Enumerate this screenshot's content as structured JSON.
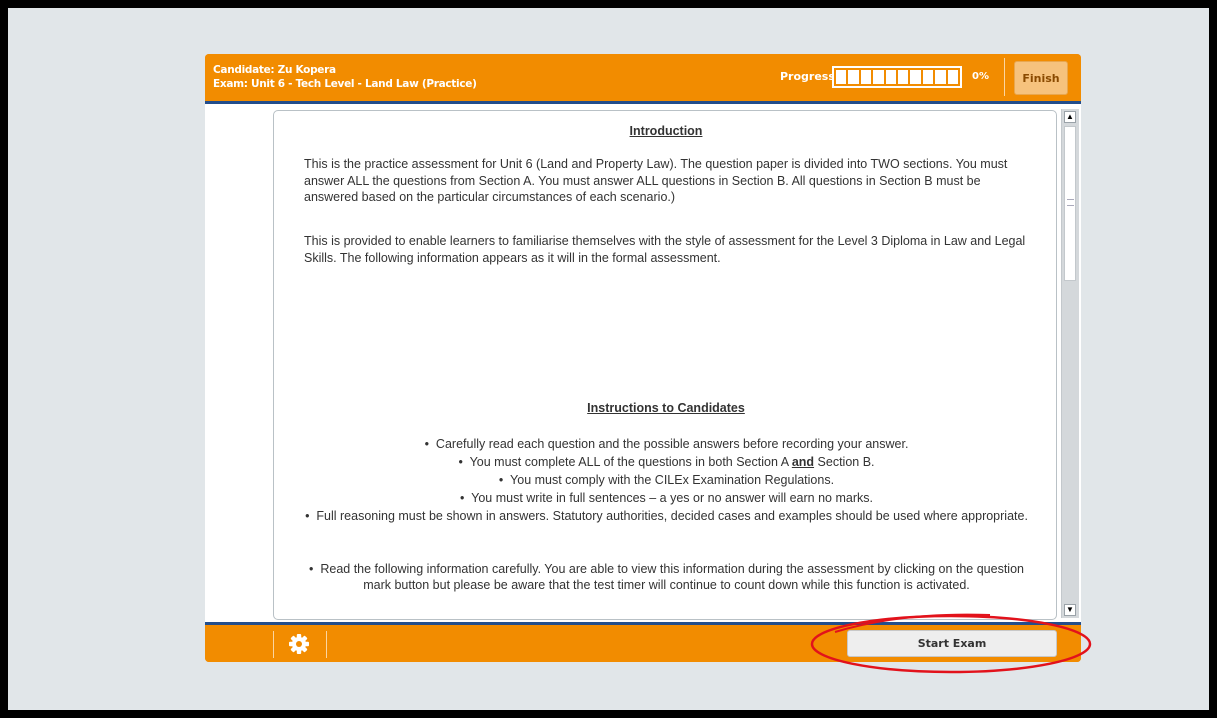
{
  "header": {
    "candidate": "Candidate: Zu Kopera",
    "exam": "Exam: Unit 6 - Tech Level - Land Law (Practice)",
    "progress_label": "Progress:",
    "progress_value": 0,
    "progress_text": "0%",
    "finish_label": "Finish"
  },
  "content": {
    "intro_heading": "Introduction",
    "intro_paragraphs": [
      "This is the practice assessment for Unit 6 (Land and Property Law). The question paper is divided into TWO sections. You must answer ALL the questions from Section A. You must answer ALL questions in Section B. All questions in Section B must be answered based on the particular circumstances of each scenario.)",
      "This is provided to enable learners to familiarise themselves with the style of assessment for the Level 3 Diploma in Law and Legal Skills. The following information appears as it will in the formal assessment."
    ],
    "instructions_heading": "Instructions to Candidates",
    "instructions": [
      "Carefully read each question and the possible answers before recording your answer.",
      {
        "before": "You must complete ALL of the questions in both Section A ",
        "emphasis": "and",
        "after": " Section B."
      },
      "You must comply with the CILEx Examination Regulations.",
      "You must write in full sentences – a yes or no answer will earn no marks.",
      "Full reasoning must be shown in answers. Statutory authorities, decided cases and examples should be used where appropriate.",
      "Read the following information carefully. You are able to view this information during the assessment by clicking on the question mark button but please be aware that the test timer will continue to count down while this function is activated."
    ],
    "bullet_char": "•"
  },
  "footer": {
    "settings_icon": "gear-icon",
    "start_exam_label": "Start Exam"
  },
  "colors": {
    "accent_orange": "#f28c00",
    "navy_rule": "#234e8c",
    "highlight_red": "#e2121b"
  }
}
